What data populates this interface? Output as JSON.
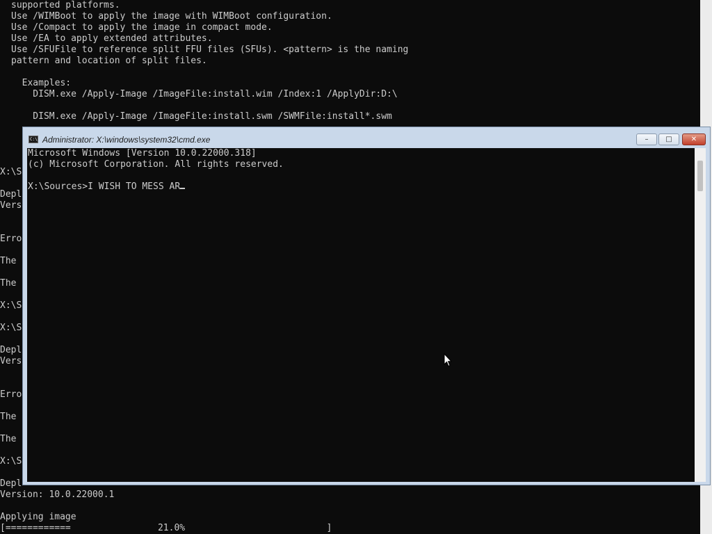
{
  "background_console": {
    "top_lines": [
      "supported platforms.",
      "Use /WIMBoot to apply the image with WIMBoot configuration.",
      "Use /Compact to apply the image in compact mode.",
      "Use /EA to apply extended attributes.",
      "Use /SFUFile to reference split FFU files (SFUs). <pattern> is the naming",
      "pattern and location of split files.",
      "",
      "  Examples:",
      "    DISM.exe /Apply-Image /ImageFile:install.wim /Index:1 /ApplyDir:D:\\",
      "",
      "    DISM.exe /Apply-Image /ImageFile:install.swm /SWMFile:install*.swm"
    ],
    "left_lines": [
      "X:\\S",
      "",
      "Depl",
      "Vers",
      "",
      "",
      "Erro",
      "",
      "The ",
      "",
      "The ",
      "",
      "X:\\S",
      "",
      "X:\\S",
      "",
      "Depl",
      "Vers",
      "",
      "",
      "Erro",
      "",
      "The ",
      "",
      "The ",
      "",
      "X:\\S"
    ],
    "bottom_lines": [
      "Depl",
      "Version: 10.0.22000.1",
      "",
      "Applying image",
      "[============                21.0%                          ]"
    ]
  },
  "cmd_window": {
    "title": "Administrator: X:\\windows\\system32\\cmd.exe",
    "icon_label": "C:\\",
    "controls": {
      "minimize": "–",
      "maximize": "□",
      "close": "✕"
    },
    "console_lines": [
      "Microsoft Windows [Version 10.0.22000.318]",
      "(c) Microsoft Corporation. All rights reserved.",
      ""
    ],
    "prompt": "X:\\Sources>",
    "typed_input": "I WISH TO MESS AR"
  }
}
